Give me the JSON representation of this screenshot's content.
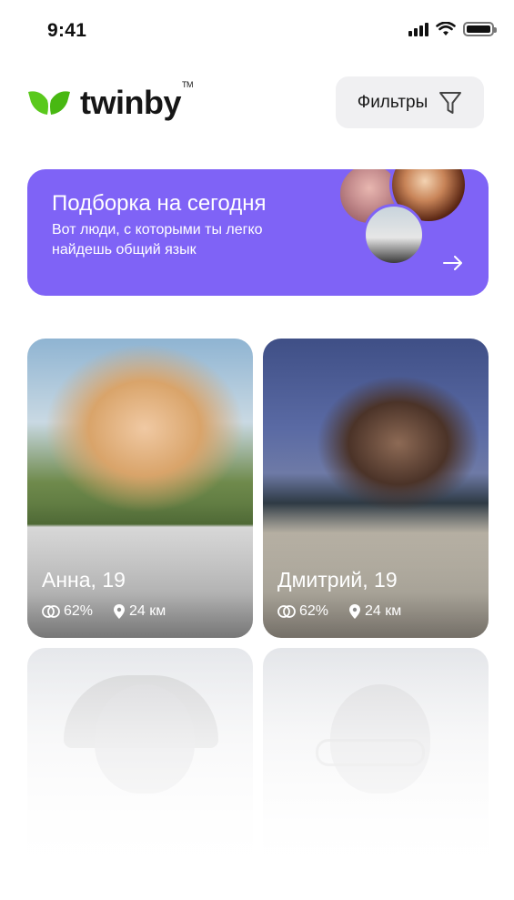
{
  "status_bar": {
    "time": "9:41"
  },
  "header": {
    "brand": "twinby",
    "brand_tm": "TM",
    "filter_label": "Фильтры"
  },
  "banner": {
    "title": "Подборка на сегодня",
    "subtitle": "Вот люди, с которыми ты легко найдешь общий язык"
  },
  "cards": [
    {
      "name": "Анна, 19",
      "match": "62%",
      "distance": "24 км"
    },
    {
      "name": "Дмитрий, 19",
      "match": "62%",
      "distance": "24 км"
    }
  ],
  "colors": {
    "accent": "#7f63f6",
    "logo_green": "#5ac91c"
  }
}
